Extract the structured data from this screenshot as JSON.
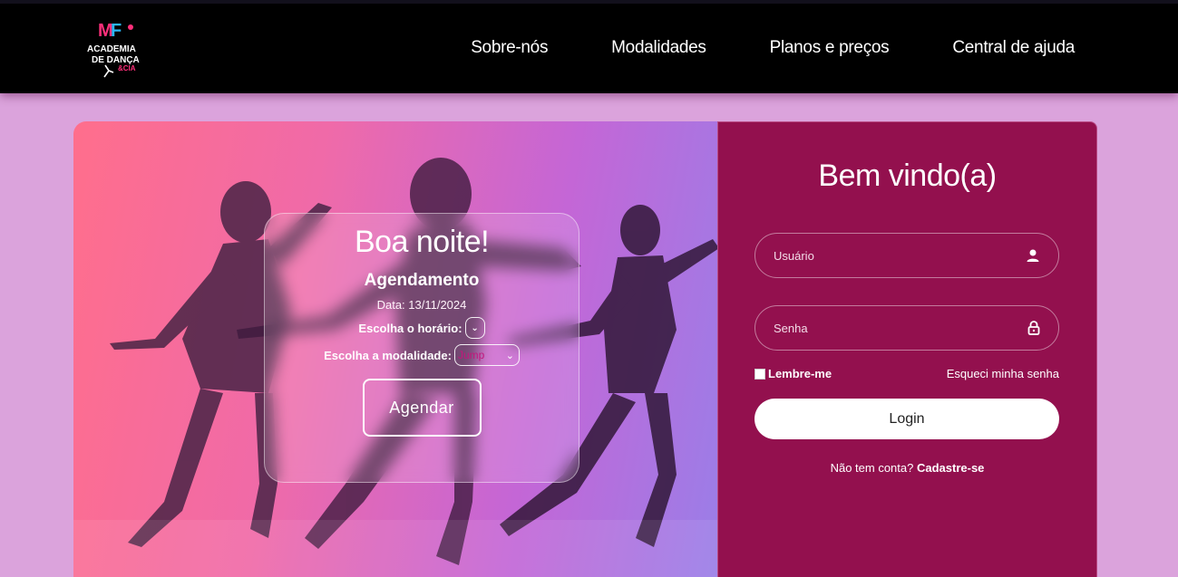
{
  "header": {
    "logo_text": "ACADEMIA DE DANÇA & CIA",
    "nav": [
      "Sobre-nós",
      "Modalidades",
      "Planos e preços",
      "Central de ajuda"
    ]
  },
  "hero": {
    "greeting": "Boa noite!",
    "schedule_title": "Agendamento",
    "date_text": "Data: 13/11/2024",
    "time_label": "Escolha o horário:",
    "time_value": "",
    "modality_label": "Escolha a modalidade:",
    "modality_value": "Jump",
    "schedule_button": "Agendar"
  },
  "login": {
    "welcome": "Bem vindo(a)",
    "username_placeholder": "Usuário",
    "password_placeholder": "Senha",
    "remember_label": "Lembre-me",
    "forgot_label": "Esqueci minha senha",
    "login_button": "Login",
    "no_account_text": "Não tem conta?",
    "signup_label": "Cadastre-se"
  },
  "colors": {
    "nav_bg": "#000000",
    "page_bg": "#dba3dc",
    "panel_bg": "#93104e",
    "accent": "#c4167c"
  },
  "icons": [
    "user-icon",
    "lock-icon",
    "chevron-down-icon"
  ]
}
